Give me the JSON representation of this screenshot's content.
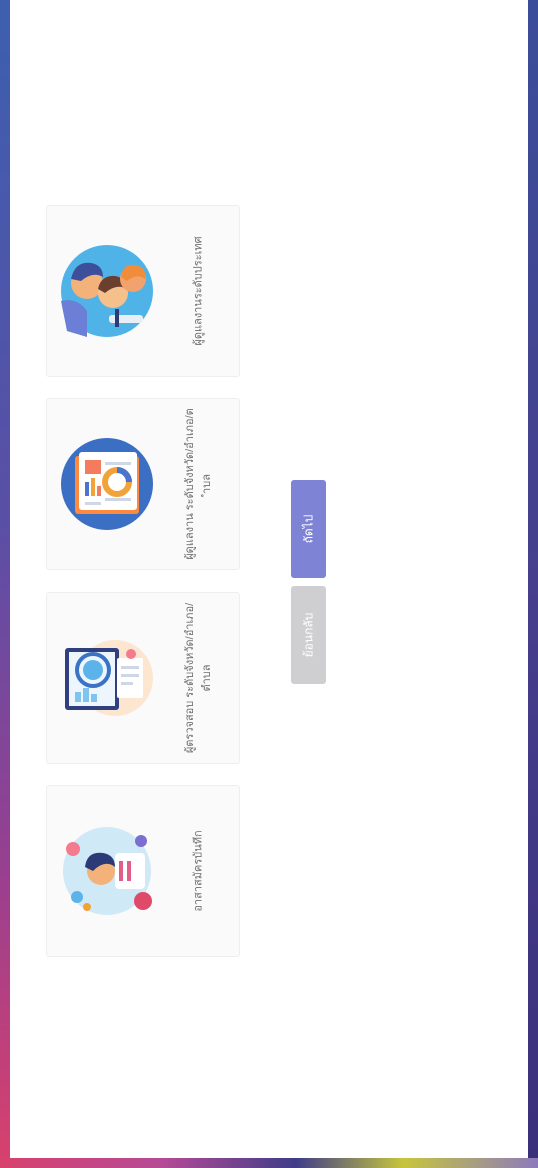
{
  "cards": [
    {
      "label": "ผู้ดูแลงานระดับประเทศ",
      "icon": "team-people-icon"
    },
    {
      "label": "ผู้ดูแลงาน ระดับจังหวัด/อำเภอ/ตำบล",
      "icon": "report-dashboard-icon"
    },
    {
      "label": "ผู้ตรวจสอบ ระดับจังหวัด/อำเภอ/ตำบล",
      "icon": "inspection-magnifier-icon"
    },
    {
      "label": "อาสาสมัครบันทึก",
      "icon": "volunteer-person-icon"
    }
  ],
  "buttons": {
    "next": "ถัดไป",
    "back": "ย้อนกลับ"
  },
  "colors": {
    "primary_button": "#7f83d6",
    "secondary_button": "#cfcfd2",
    "frame_left": "#5a4fa6",
    "frame_right": "#3b3480"
  }
}
